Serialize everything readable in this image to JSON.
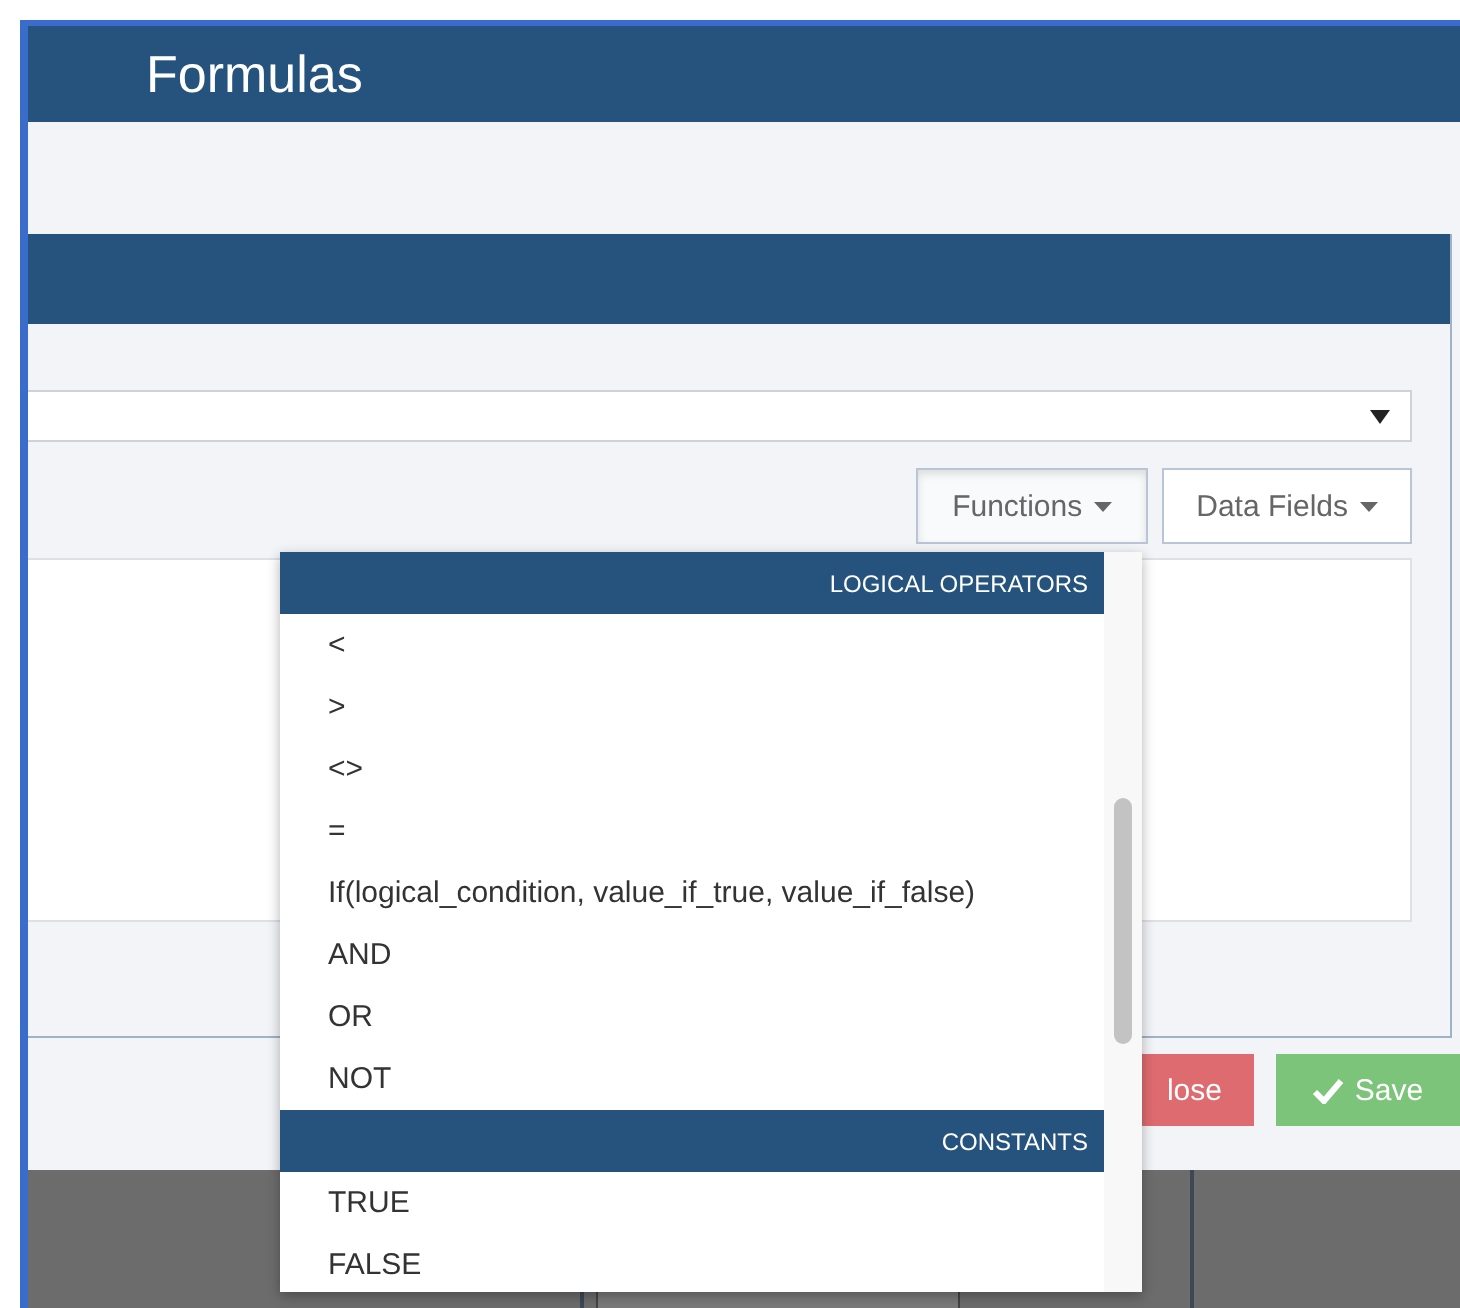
{
  "window": {
    "title": "Formulas"
  },
  "toolbar_buttons": [
    {
      "label": "Functions",
      "expanded": true
    },
    {
      "label": "Data Fields",
      "expanded": false
    }
  ],
  "footer_buttons": [
    {
      "label": "lose",
      "kind": "danger"
    },
    {
      "label": "Save",
      "kind": "success"
    }
  ],
  "functions_menu": {
    "sections": [
      {
        "heading": "LOGICAL OPERATORS",
        "items": [
          "<",
          ">",
          "<>",
          "=",
          "If(logical_condition, value_if_true, value_if_false)",
          "AND",
          "OR",
          "NOT"
        ]
      },
      {
        "heading": "CONSTANTS",
        "items": [
          "TRUE",
          "FALSE"
        ]
      }
    ]
  }
}
